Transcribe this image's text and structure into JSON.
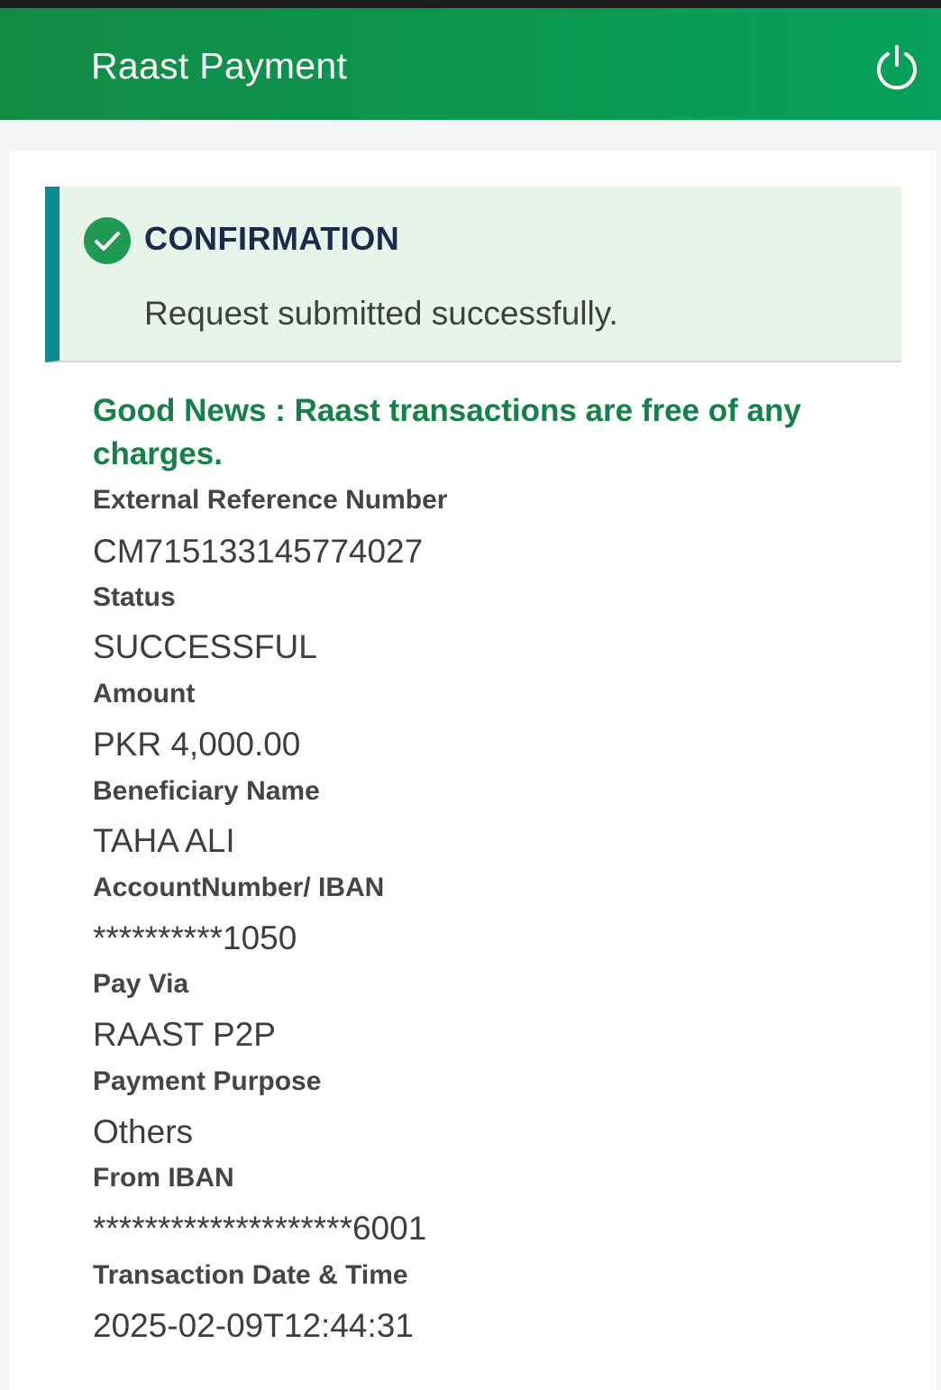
{
  "header": {
    "title": "Raast Payment",
    "power_icon": "power-icon",
    "background_color": "#0a9a50"
  },
  "confirmation": {
    "title": "CONFIRMATION",
    "message": "Request submitted successfully.",
    "icon": "check-circle-icon",
    "accent_color": "#0c8a8f"
  },
  "notice": {
    "text": "Good News : Raast transactions are free of any charges."
  },
  "details": [
    {
      "label": "External Reference Number",
      "value": "CM715133145774027"
    },
    {
      "label": "Status",
      "value": "SUCCESSFUL"
    },
    {
      "label": "Amount",
      "value": "PKR 4,000.00"
    },
    {
      "label": "Beneficiary Name",
      "value": "TAHA ALI"
    },
    {
      "label": "AccountNumber/ IBAN",
      "value": "**********1050"
    },
    {
      "label": "Pay Via",
      "value": "RAAST P2P"
    },
    {
      "label": "Payment Purpose",
      "value": "Others"
    },
    {
      "label": "From IBAN",
      "value": "********************6001"
    },
    {
      "label": "Transaction Date & Time",
      "value": "2025-02-09T12:44:31"
    }
  ]
}
